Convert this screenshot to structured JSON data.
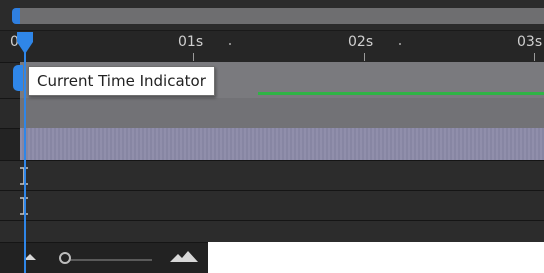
{
  "ruler": {
    "labels": [
      "0s",
      "01s",
      "02s",
      "03s"
    ]
  },
  "tooltip": {
    "text": "Current Time Indicator"
  },
  "colors": {
    "playhead": "#2f86e8",
    "audio_wave": "#2fb445",
    "layer_purple": "#8b8aa8",
    "layer_gray": "#7a7a7e"
  },
  "icons": {
    "zoom_out": "mountain-small-icon",
    "zoom_in": "mountain-large-icon",
    "zoom_knob": "slider-knob-icon",
    "in_point": "i-beam-marker-icon"
  }
}
